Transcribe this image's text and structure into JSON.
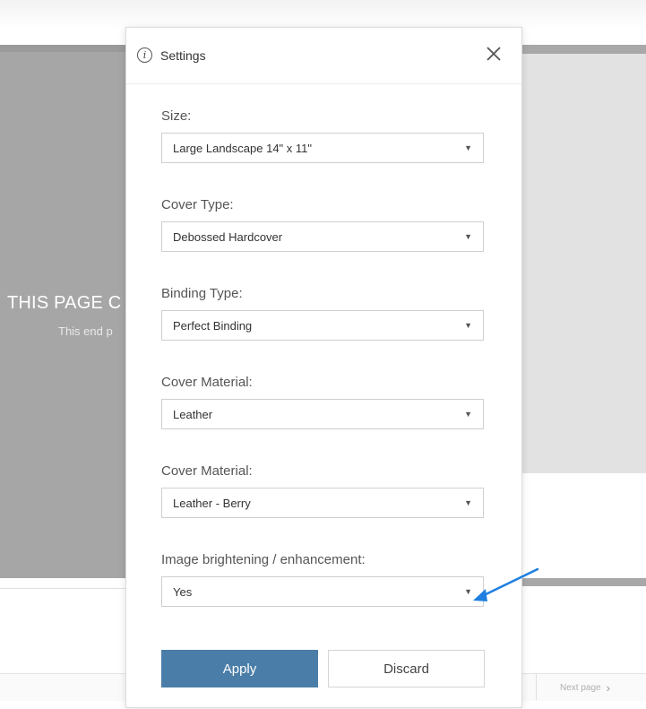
{
  "background_page": {
    "title": "THIS PAGE C",
    "subtitle": "This end p",
    "next_page_label": "Next page"
  },
  "modal": {
    "title": "Settings",
    "fields": [
      {
        "label": "Size:",
        "value": "Large Landscape 14\" x 11\""
      },
      {
        "label": "Cover Type:",
        "value": "Debossed Hardcover"
      },
      {
        "label": "Binding Type:",
        "value": "Perfect Binding"
      },
      {
        "label": "Cover Material:",
        "value": "Leather"
      },
      {
        "label": "Cover Material:",
        "value": "Leather - Berry"
      },
      {
        "label": "Image brightening / enhancement:",
        "value": "Yes"
      }
    ],
    "apply_label": "Apply",
    "discard_label": "Discard"
  },
  "colors": {
    "primary_button": "#4a7ea8",
    "annotation_arrow": "#1e7fe0"
  },
  "icons": {
    "info": "info-icon",
    "close": "close-icon",
    "dropdown": "chevron-down-icon",
    "next": "chevron-right-icon"
  }
}
